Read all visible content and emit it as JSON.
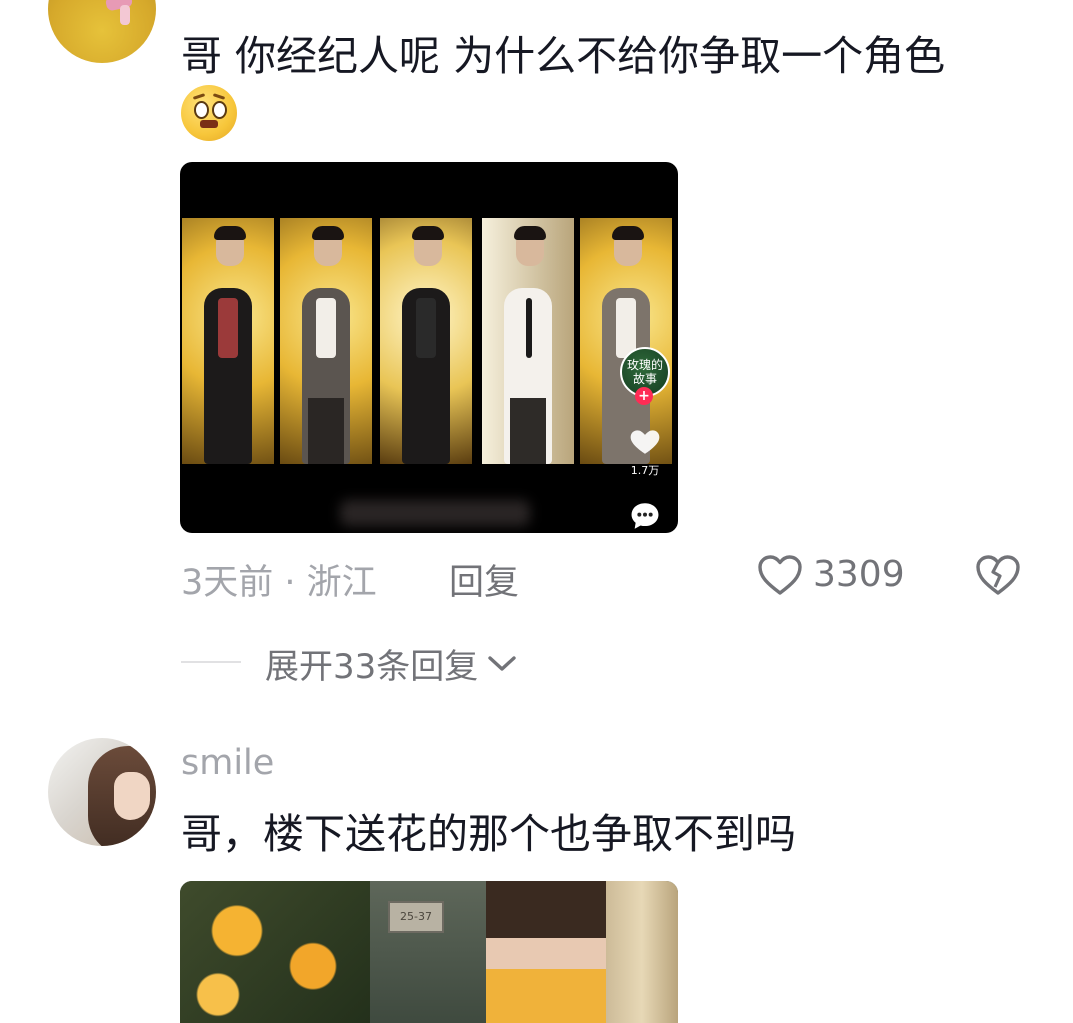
{
  "comments": [
    {
      "text": "哥 你经纪人呢 为什么不给你争取一个角色",
      "emoji": "pleading-face-emoji",
      "video": {
        "music_disc_label": "玫瑰的故事",
        "like_count": "1.7万",
        "icons": [
          "heart-icon",
          "comment-bubble-icon",
          "follow-plus-icon"
        ]
      },
      "time_location": "3天前 · 浙江",
      "reply_label": "回复",
      "like_count": "3309",
      "expand_label": "展开33条回复"
    },
    {
      "username": "smile",
      "text": "哥，楼下送花的那个也争取不到吗",
      "image_sign_text": "25-37"
    }
  ],
  "colors": {
    "primary_text": "#161823",
    "secondary_text": "#a3a5ab",
    "action_text": "#727378",
    "accent": "#fe2c55"
  }
}
